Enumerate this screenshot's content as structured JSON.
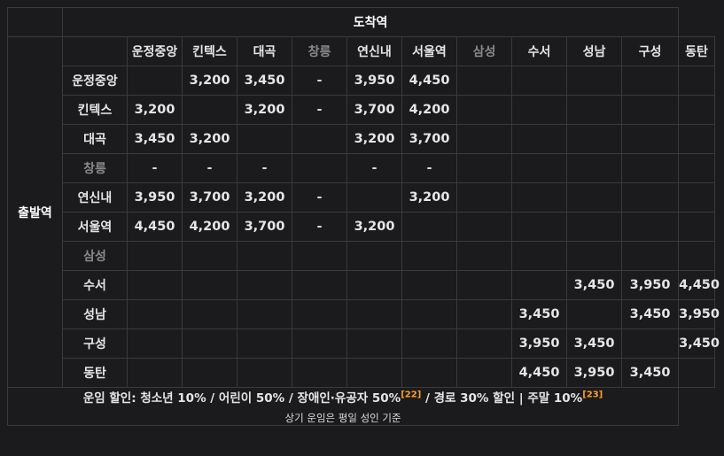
{
  "arrival_label": "도착역",
  "departure_label": "출발역",
  "stations": [
    {
      "name": "운정중앙",
      "muted": false
    },
    {
      "name": "킨텍스",
      "muted": false
    },
    {
      "name": "대곡",
      "muted": false
    },
    {
      "name": "창릉",
      "muted": true
    },
    {
      "name": "연신내",
      "muted": false
    },
    {
      "name": "서울역",
      "muted": false
    },
    {
      "name": "삼성",
      "muted": true
    },
    {
      "name": "수서",
      "muted": false
    },
    {
      "name": "성남",
      "muted": false
    },
    {
      "name": "구성",
      "muted": false
    },
    {
      "name": "동탄",
      "muted": false
    }
  ],
  "fares": [
    [
      "",
      "3,200",
      "3,450",
      "-",
      "3,950",
      "4,450",
      "",
      "",
      "",
      "",
      ""
    ],
    [
      "3,200",
      "",
      "3,200",
      "-",
      "3,700",
      "4,200",
      "",
      "",
      "",
      "",
      ""
    ],
    [
      "3,450",
      "3,200",
      "",
      "",
      "3,200",
      "3,700",
      "",
      "",
      "",
      "",
      ""
    ],
    [
      "-",
      "-",
      "-",
      "",
      "-",
      "-",
      "",
      "",
      "",
      "",
      ""
    ],
    [
      "3,950",
      "3,700",
      "3,200",
      "-",
      "",
      "3,200",
      "",
      "",
      "",
      "",
      ""
    ],
    [
      "4,450",
      "4,200",
      "3,700",
      "-",
      "3,200",
      "",
      "",
      "",
      "",
      "",
      ""
    ],
    [
      "",
      "",
      "",
      "",
      "",
      "",
      "",
      "",
      "",
      "",
      ""
    ],
    [
      "",
      "",
      "",
      "",
      "",
      "",
      "",
      "",
      "3,450",
      "3,950",
      "4,450"
    ],
    [
      "",
      "",
      "",
      "",
      "",
      "",
      "",
      "3,450",
      "",
      "3,450",
      "3,950"
    ],
    [
      "",
      "",
      "",
      "",
      "",
      "",
      "",
      "3,950",
      "3,450",
      "",
      "3,450"
    ],
    [
      "",
      "",
      "",
      "",
      "",
      "",
      "",
      "4,450",
      "3,950",
      "3,450",
      ""
    ]
  ],
  "footer": {
    "part1": "운임 할인: 청소년 10% / 어린이 50% / 장애인·유공자 50%",
    "ref1": "[22]",
    "part2": " / 경로 30% 할인 | 주말 10%",
    "ref2": "[23]",
    "sub": "상기 운임은 평일 성인 기준"
  }
}
